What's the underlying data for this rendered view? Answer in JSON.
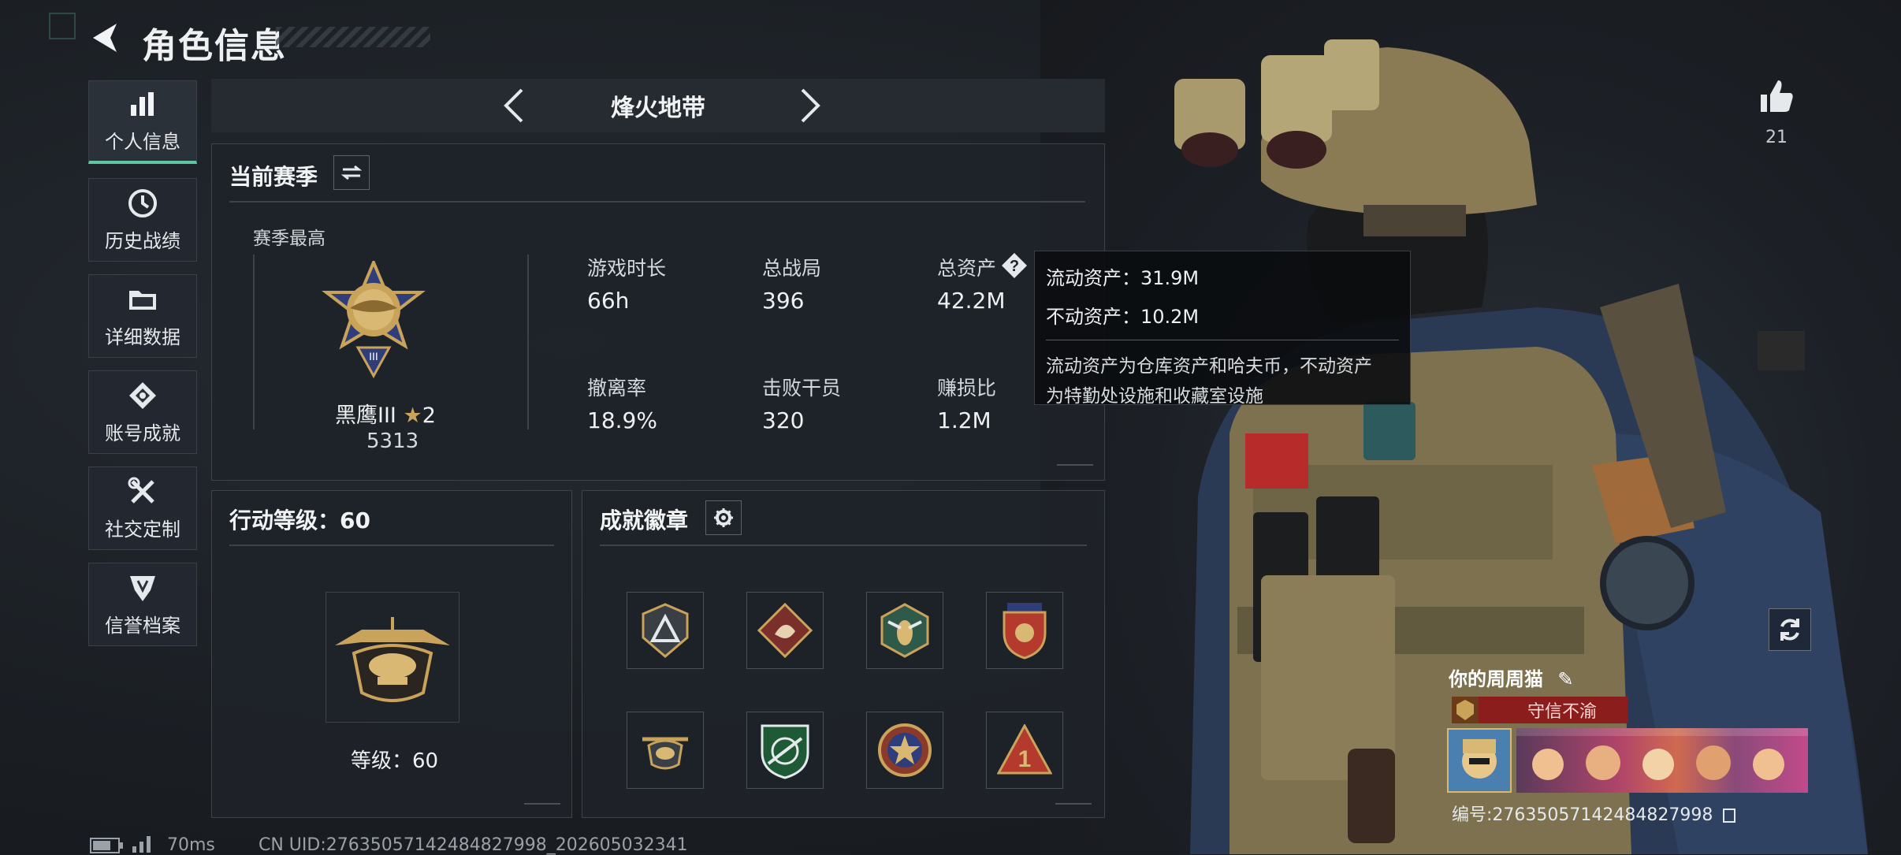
{
  "page": {
    "title": "角色信息"
  },
  "sidebar": {
    "items": [
      {
        "label": "个人信息",
        "icon": "bar-chart-icon",
        "active": true
      },
      {
        "label": "历史战绩",
        "icon": "clock-history-icon",
        "active": false
      },
      {
        "label": "详细数据",
        "icon": "folder-icon",
        "active": false
      },
      {
        "label": "账号成就",
        "icon": "achievement-icon",
        "active": false
      },
      {
        "label": "社交定制",
        "icon": "wrench-screwdriver-icon",
        "active": false
      },
      {
        "label": "信誉档案",
        "icon": "shield-badge-icon",
        "active": false
      }
    ]
  },
  "mode": {
    "label": "烽火地带"
  },
  "season": {
    "title": "当前赛季",
    "best_label": "赛季最高",
    "rank_name": "黑鹰III",
    "rank_stars": "2",
    "rank_score": "5313",
    "stats": [
      {
        "label": "游戏时长",
        "value": "66h"
      },
      {
        "label": "总战局",
        "value": "396"
      },
      {
        "label": "总资产",
        "value": "42.2M"
      },
      {
        "label": "撤离率",
        "value": "18.9%"
      },
      {
        "label": "击败干员",
        "value": "320"
      },
      {
        "label": "赚损比",
        "value": "1.2M"
      }
    ]
  },
  "tooltip": {
    "liquid": "流动资产：31.9M",
    "fixed": "不动资产：10.2M",
    "desc_line1": "流动资产为仓库资产和哈夫币，不动资产",
    "desc_line2": "为特勤处设施和收藏室设施"
  },
  "action_level": {
    "title": "行动等级：60",
    "level_text": "等级：60"
  },
  "badges": {
    "title": "成就徽章",
    "items": [
      "triangle-badge-icon",
      "dragon-badge-icon",
      "wasp-badge-icon",
      "shield-crest-badge-icon",
      "helicopter-badge-icon",
      "rifle-badge-icon",
      "star-badge-icon",
      "number-one-badge-icon"
    ]
  },
  "right": {
    "likes": "21",
    "player_name": "你的周周猫",
    "title_tag": "守信不渝",
    "id_text": "编号:2763505714248482799​8"
  },
  "status_bar": {
    "ping": "70ms",
    "uid": "CN UID:27635057142484827998_202605032341"
  },
  "colors": {
    "accent": "#5fc7a0",
    "gold": "#c9a35a",
    "tag_red": "#8b1d1d"
  }
}
